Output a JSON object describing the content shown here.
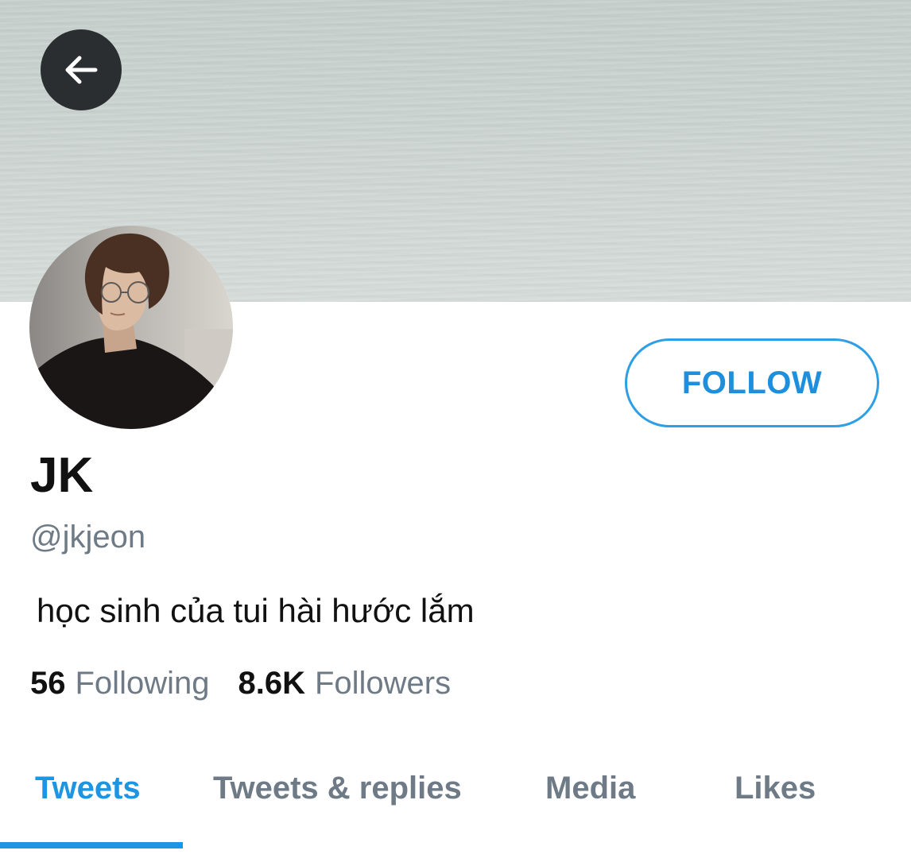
{
  "header": {
    "back_icon": "arrow-left-icon"
  },
  "profile": {
    "display_name": "JK",
    "handle": "@jkjeon",
    "bio": "học sinh của tui hài hước lắm",
    "follow_label": "FOLLOW"
  },
  "stats": {
    "following_count": "56",
    "following_label": "Following",
    "followers_count": "8.6K",
    "followers_label": "Followers"
  },
  "tabs": [
    {
      "label": "Tweets",
      "active": true
    },
    {
      "label": "Tweets & replies",
      "active": false
    },
    {
      "label": "Media",
      "active": false
    },
    {
      "label": "Likes",
      "active": false
    }
  ],
  "colors": {
    "accent": "#1d95e0",
    "secondary_text": "#6e7b86",
    "primary_text": "#111111",
    "back_button_bg": "#2a2e30"
  }
}
